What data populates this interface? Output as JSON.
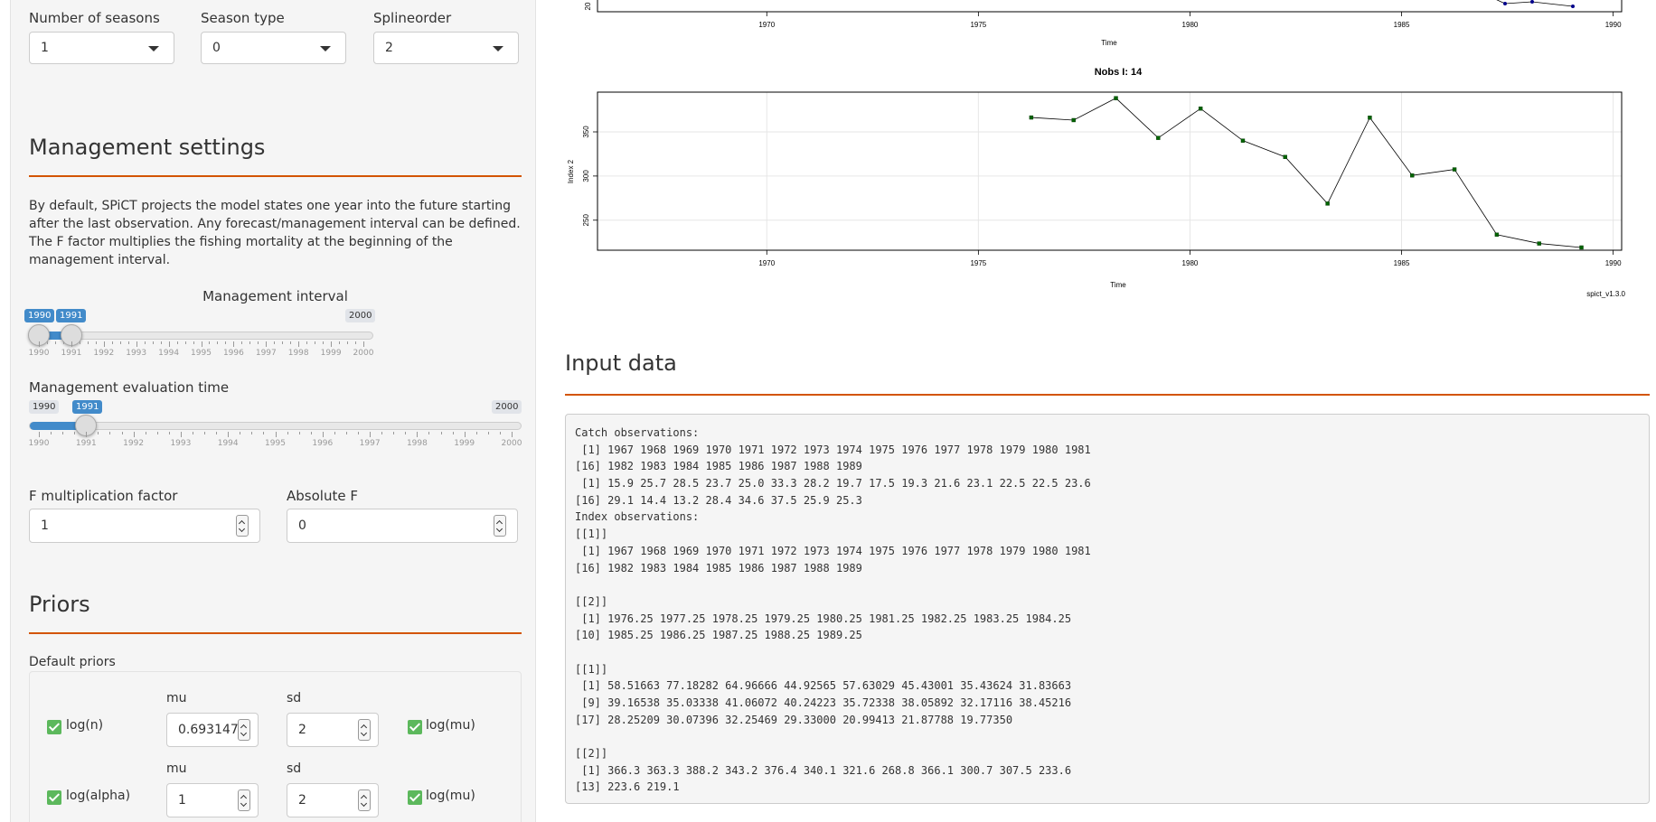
{
  "top_selects": [
    {
      "label": "Number of seasons",
      "value": "1"
    },
    {
      "label": "Season type",
      "value": "0"
    },
    {
      "label": "Splineorder",
      "value": "2"
    }
  ],
  "management": {
    "title": "Management settings",
    "description": "By default, SPiCT projects the model states one year into the future starting after the last observation. Any forecast/management interval can be defined. The F factor multiplies the fishing mortality at the beginning of the management interval.",
    "interval_label": "Management interval",
    "interval_from": "1990",
    "interval_to": "1991",
    "interval_max": "2000",
    "interval_ticks": [
      "1990",
      "1991",
      "1992",
      "1993",
      "1994",
      "1995",
      "1996",
      "1997",
      "1998",
      "1999",
      "2000"
    ],
    "eval_label": "Management evaluation time",
    "eval_min": "1990",
    "eval_value": "1991",
    "eval_max": "2000",
    "eval_ticks": [
      "1990",
      "1991",
      "1992",
      "1993",
      "1994",
      "1995",
      "1996",
      "1997",
      "1998",
      "1999",
      "2000"
    ],
    "ffac_label": "F multiplication factor",
    "ffac_value": "1",
    "absf_label": "Absolute F",
    "absf_value": "0"
  },
  "priors": {
    "title": "Priors",
    "default_label": "Default priors",
    "rows": [
      {
        "name": "log(n)",
        "mu_label": "mu",
        "mu": "0.6931471",
        "sd_label": "sd",
        "sd": "2",
        "logmu": "log(mu)"
      },
      {
        "name": "log(alpha)",
        "mu_label": "mu",
        "mu": "1",
        "sd_label": "sd",
        "sd": "2",
        "logmu": "log(mu)"
      }
    ]
  },
  "plot_top": {
    "xticks": [
      "1970",
      "1975",
      "1980",
      "1985",
      "1990"
    ],
    "xlabel": "Time",
    "ytick": "20"
  },
  "chart_data": {
    "type": "line",
    "title": "Nobs I: 14",
    "xlabel": "Time",
    "ylabel": "Index 2",
    "xlim": [
      1966,
      1990.2
    ],
    "ylim": [
      216,
      395
    ],
    "xticks": [
      "1970",
      "1975",
      "1980",
      "1985",
      "1990"
    ],
    "yticks": [
      "250",
      "300",
      "350"
    ],
    "x": [
      1976.25,
      1977.25,
      1978.25,
      1979.25,
      1980.25,
      1981.25,
      1982.25,
      1983.25,
      1984.25,
      1985.25,
      1986.25,
      1987.25,
      1988.25,
      1989.25
    ],
    "values": [
      366.3,
      363.3,
      388.2,
      343.2,
      376.4,
      340.1,
      321.6,
      268.8,
      366.1,
      300.7,
      307.5,
      233.6,
      223.6,
      219.1
    ],
    "line_color": "#000000",
    "point_color": "#006400",
    "footer": "spict_v1.3.0",
    "grid": true
  },
  "input_data": {
    "title": "Input data",
    "lines": [
      "Catch observations:",
      " [1] 1967 1968 1969 1970 1971 1972 1973 1974 1975 1976 1977 1978 1979 1980 1981",
      "[16] 1982 1983 1984 1985 1986 1987 1988 1989",
      " [1] 15.9 25.7 28.5 23.7 25.0 33.3 28.2 19.7 17.5 19.3 21.6 23.1 22.5 22.5 23.6",
      "[16] 29.1 14.4 13.2 28.4 34.6 37.5 25.9 25.3",
      "Index observations:",
      "[[1]]",
      " [1] 1967 1968 1969 1970 1971 1972 1973 1974 1975 1976 1977 1978 1979 1980 1981",
      "[16] 1982 1983 1984 1985 1986 1987 1988 1989",
      "",
      "[[2]]",
      " [1] 1976.25 1977.25 1978.25 1979.25 1980.25 1981.25 1982.25 1983.25 1984.25",
      "[10] 1985.25 1986.25 1987.25 1988.25 1989.25",
      "",
      "[[1]]",
      " [1] 58.51663 77.18282 64.96666 44.92565 57.63029 45.43001 35.43624 31.83663",
      " [9] 39.16538 35.03338 41.06072 40.24223 35.72338 38.05892 32.17116 38.45216",
      "[17] 28.25209 30.07396 32.25469 29.33000 20.99413 21.87788 19.77350",
      "",
      "[[2]]",
      " [1] 366.3 363.3 388.2 343.2 376.4 340.1 321.6 268.8 366.1 300.7 307.5 233.6",
      "[13] 223.6 219.1"
    ]
  }
}
